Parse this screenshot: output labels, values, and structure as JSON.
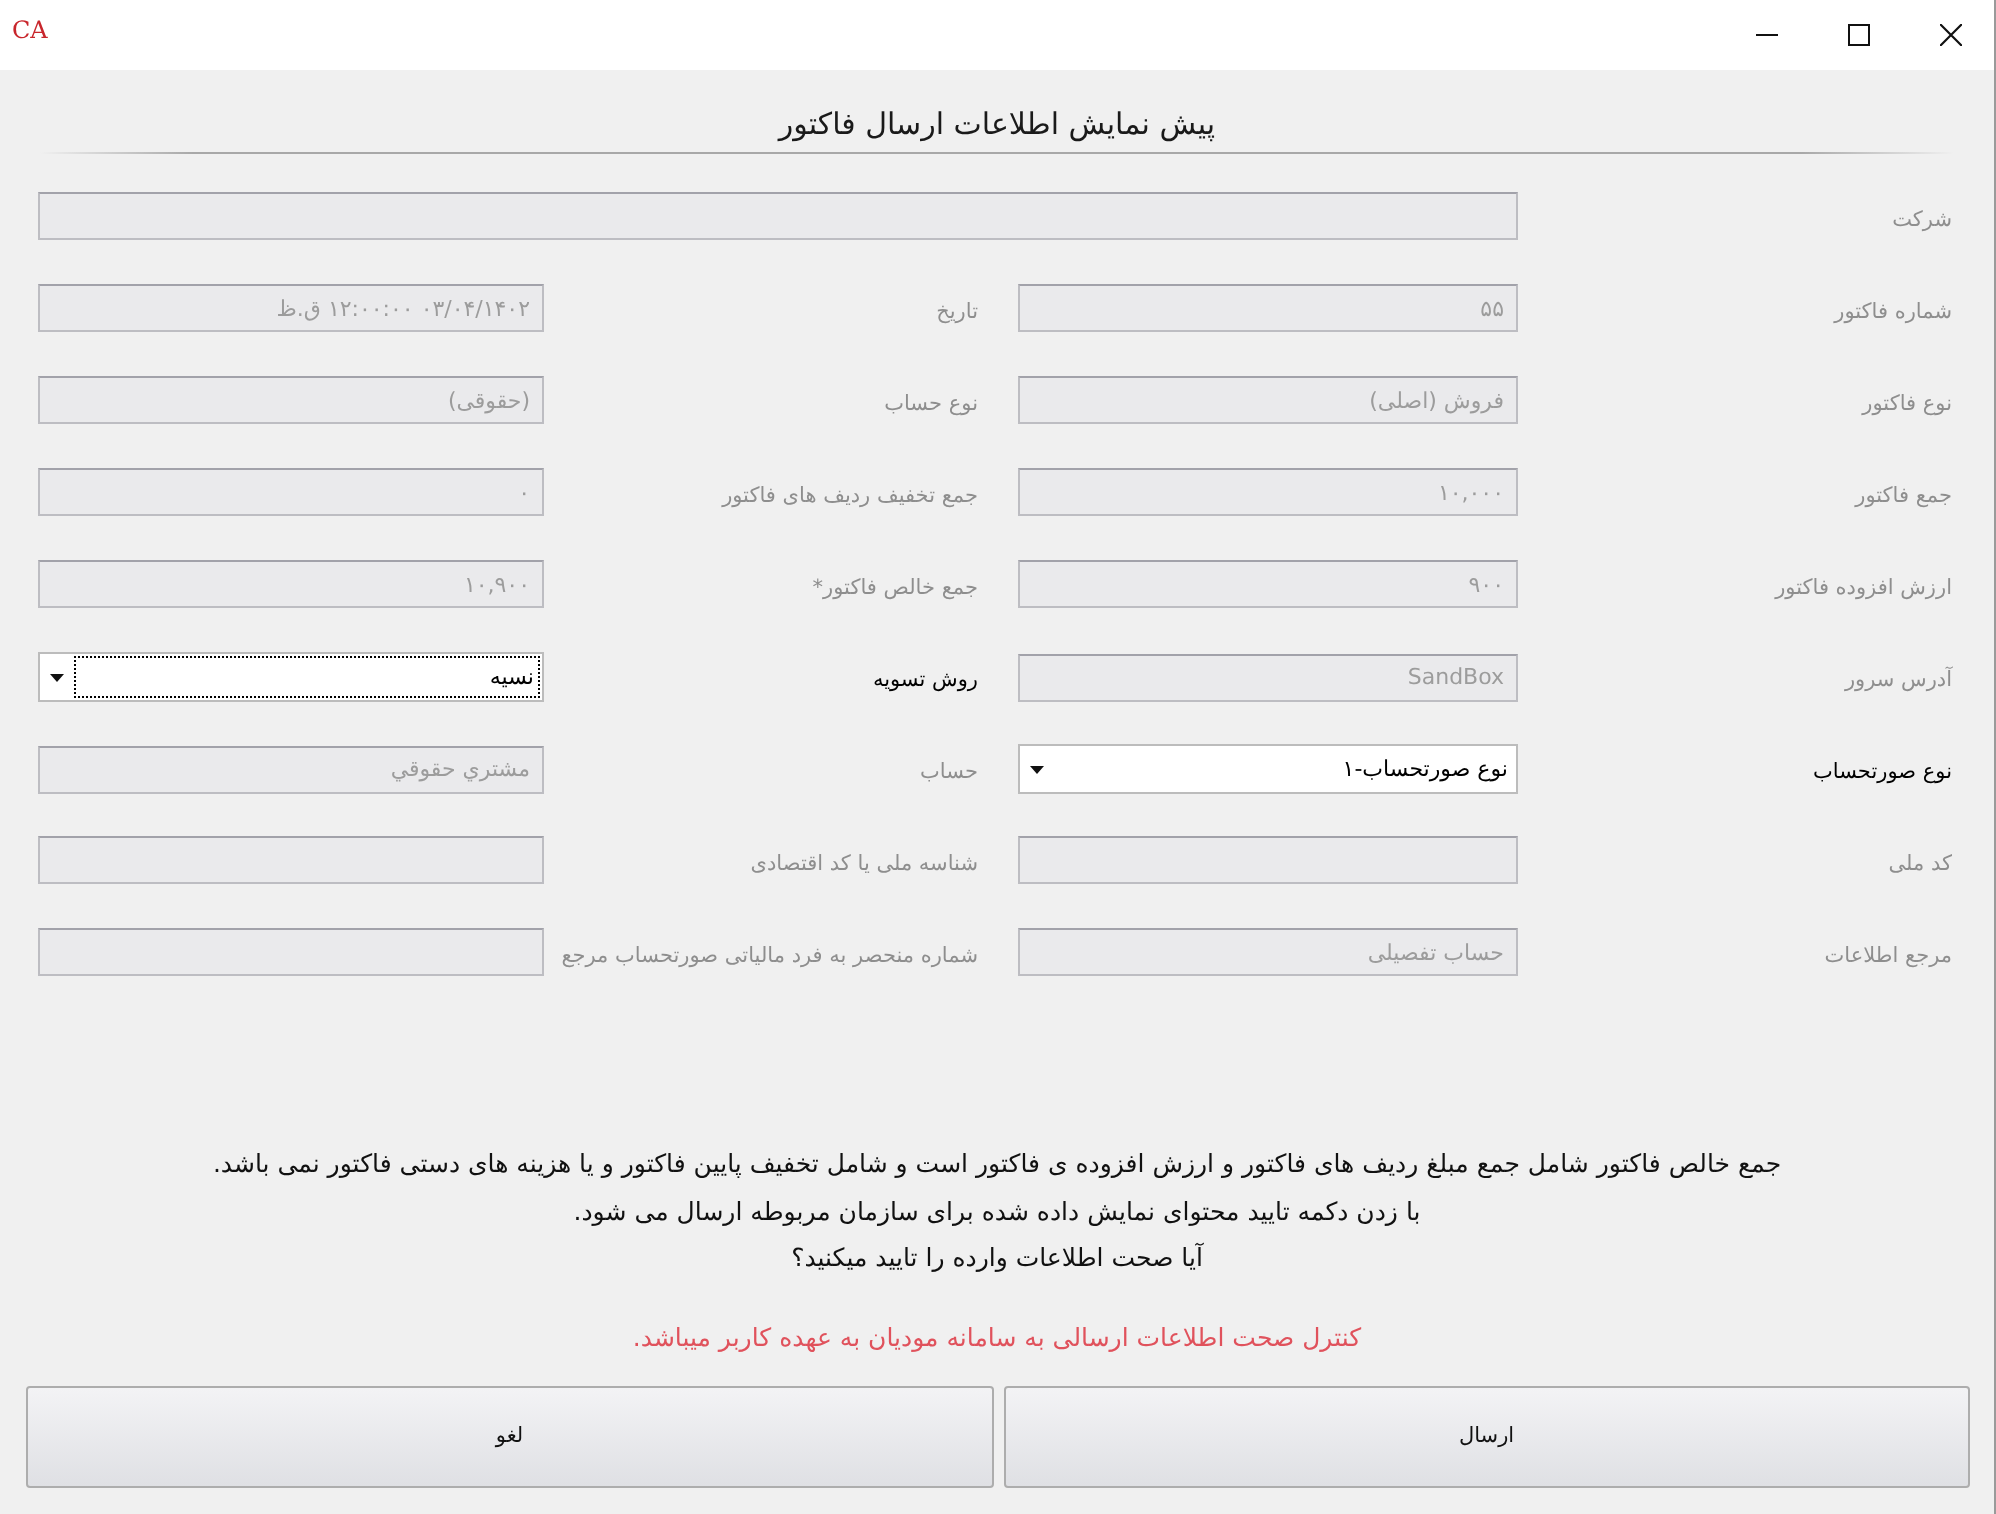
{
  "window": {
    "logo": "CA"
  },
  "heading": "پیش نمایش اطلاعات ارسال فاکتور",
  "company": {
    "label": "شرکت",
    "disabled": true
  },
  "fields": [
    {
      "label": "شماره فاکتور",
      "kind": "text",
      "value": "۵۵",
      "disabled": true,
      "focused": false
    },
    {
      "label": "تاریخ",
      "kind": "text",
      "value": "۰۳/۰۴/۱۴۰۲ ۱۲:۰۰:۰۰ ق.ظ",
      "disabled": true,
      "focused": false
    },
    {
      "label": "نوع فاکتور",
      "kind": "text",
      "value": "فروش (اصلی)",
      "disabled": true,
      "focused": false
    },
    {
      "label": "نوع حساب",
      "kind": "text",
      "value": "(حقوقی)",
      "disabled": true,
      "focused": false
    },
    {
      "label": "جمع فاکتور",
      "kind": "text",
      "value": "۱۰,۰۰۰",
      "disabled": true,
      "focused": false
    },
    {
      "label": "جمع تخفیف ردیف های فاکتور",
      "kind": "text",
      "value": "۰",
      "disabled": true,
      "focused": false
    },
    {
      "label": "ارزش افزوده فاکتور",
      "kind": "text",
      "value": "۹۰۰",
      "disabled": true,
      "focused": false
    },
    {
      "label": "جمع خالص فاکتور*",
      "kind": "text",
      "value": "۱۰,۹۰۰",
      "disabled": true,
      "focused": false
    },
    {
      "label": "آدرس سرور",
      "kind": "text",
      "value": "SandBox",
      "disabled": true,
      "focused": false
    },
    {
      "label": "روش تسویه",
      "kind": "combo",
      "value": "نسیه",
      "disabled": false,
      "focused": true
    },
    {
      "label": "نوع صورتحساب",
      "kind": "combo",
      "value": "نوع صورتحساب-۱",
      "disabled": false,
      "focused": false
    },
    {
      "label": "حساب",
      "kind": "text",
      "value": "مشتري حقوقي",
      "disabled": true,
      "focused": false
    },
    {
      "label": "کد ملی",
      "kind": "text",
      "disabled": true,
      "focused": false
    },
    {
      "label": "شناسه ملی یا کد اقتصادی",
      "kind": "text",
      "disabled": true,
      "focused": false
    },
    {
      "label": "مرجع اطلاعات",
      "kind": "text",
      "value": "حساب تفصیلی",
      "disabled": true,
      "focused": false
    },
    {
      "label": "شماره منحصر به فرد مالیاتی صورتحساب مرجع",
      "kind": "text",
      "disabled": true,
      "focused": false
    }
  ],
  "notes": [
    "جمع خالص فاکتور شامل جمع مبلغ ردیف های فاکتور و ارزش افزوده ی فاکتور است و شامل تخفیف پایین فاکتور و یا هزینه های دستی فاکتور نمی باشد.",
    "با زدن دکمه تایید محتوای نمایش داده شده برای سازمان مربوطه ارسال می شود.",
    "آیا صحت اطلاعات وارده را تایید میکنید؟"
  ],
  "warning": "کنترل صحت اطلاعات ارسالی به سامانه مودیان به عهده کاربر میباشد.",
  "buttons": [
    "ارسال",
    "لغو"
  ]
}
